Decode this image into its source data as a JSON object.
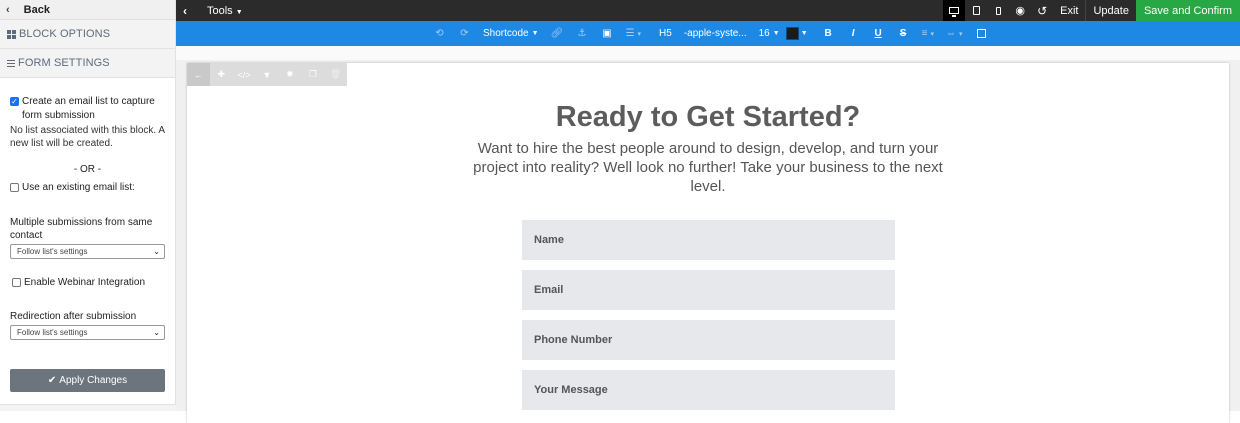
{
  "sidebar": {
    "back_label": "Back",
    "block_options_label": "BLOCK OPTIONS",
    "form_settings_label": "FORM SETTINGS",
    "create_list_label": "Create an email list to capture form submission",
    "create_list_checked": true,
    "no_list_note": "No list associated with this block. A new list will be created.",
    "or_label": "- OR -",
    "existing_list_label": "Use an existing email list:",
    "multiple_submissions_label": "Multiple submissions from same contact",
    "multiple_submissions_value": "Follow list's settings",
    "webinar_label": "Enable Webinar Integration",
    "redirection_label": "Redirection after submission",
    "redirection_value": "Follow list's settings",
    "apply_label": "Apply Changes"
  },
  "topbar": {
    "tools_label": "Tools",
    "exit_label": "Exit",
    "update_label": "Update",
    "save_confirm_label": "Save and Confirm"
  },
  "editbar": {
    "shortcode_label": "Shortcode",
    "heading_label": "H5",
    "font_label": "-apple-syste...",
    "size_label": "16",
    "text_color": "#1b1b1b"
  },
  "page": {
    "title": "Ready to Get Started?",
    "subtitle": "Want to hire the best people around to design, develop, and turn your project into reality? Well look no further! Take your business to the next level.",
    "fields": [
      "Name",
      "Email",
      "Phone Number",
      "Your Message"
    ]
  },
  "colors": {
    "toolbar_blue": "#1e88e5",
    "save_green": "#28a745",
    "apply_gray": "#6c757d"
  }
}
